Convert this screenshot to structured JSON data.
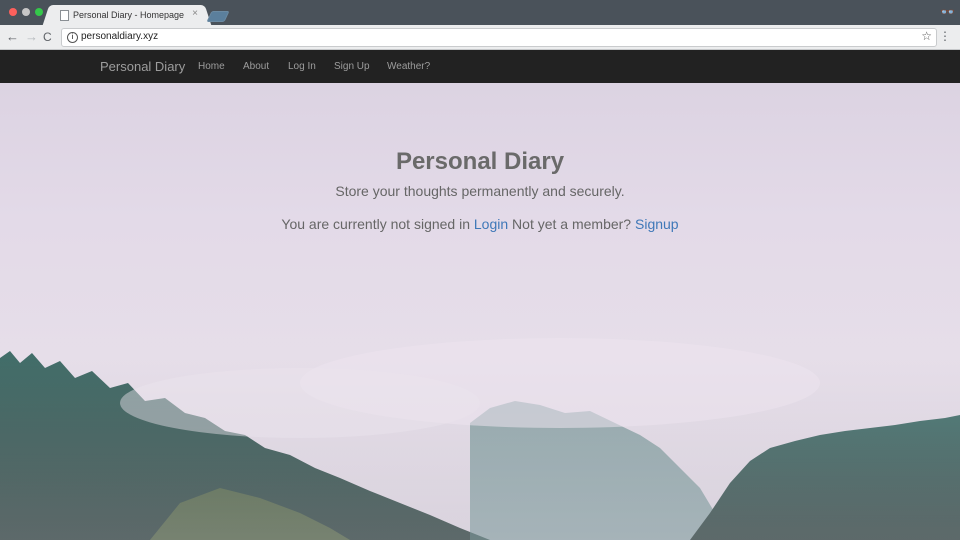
{
  "browser": {
    "tab_title": "Personal Diary - Homepage",
    "tab_close": "×",
    "url": "personaldiary.xyz",
    "back_glyph": "←",
    "forward_glyph": "→",
    "reload_glyph": "C",
    "star_glyph": "☆",
    "menu_glyph": "⋮",
    "incognito_glyph": "👓"
  },
  "nav": {
    "brand": "Personal Diary",
    "links": [
      "Home",
      "About",
      "Log In",
      "Sign Up",
      "Weather?"
    ]
  },
  "hero": {
    "title": "Personal Diary",
    "subtitle": "Store your thoughts permanently and securely.",
    "status_text": "You are currently not signed in",
    "login_link": "Login",
    "member_prompt": "Not yet a member?",
    "signup_link": "Signup"
  },
  "colors": {
    "navbar_bg": "#222222",
    "link": "#3f78b8",
    "nav_text": "#9d9d9d"
  }
}
